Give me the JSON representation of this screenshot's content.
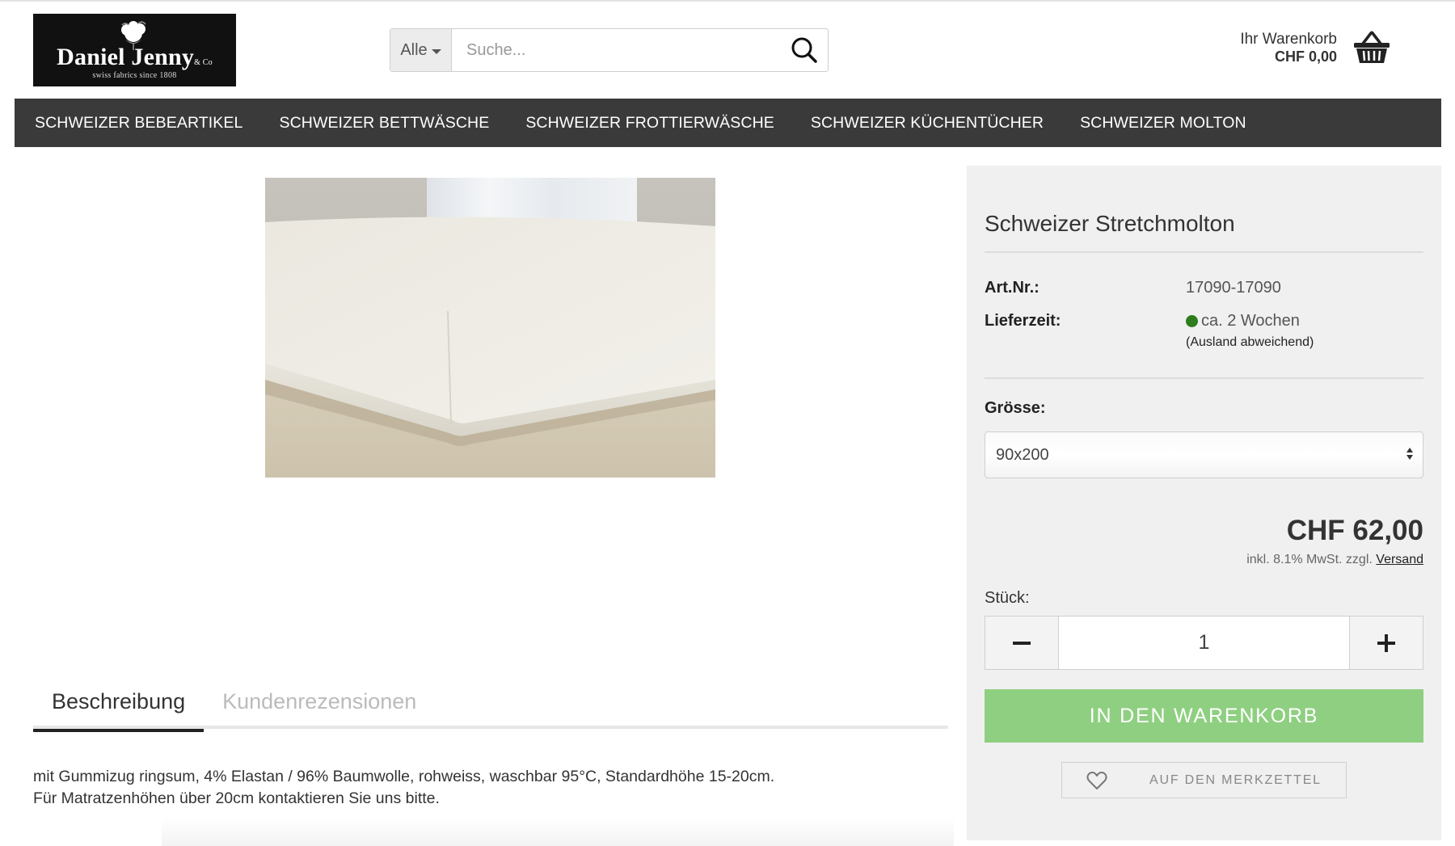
{
  "brand": {
    "name": "Daniel Jenny",
    "suffix": "& Co",
    "tagline": "swiss fabrics since 1808"
  },
  "search": {
    "category": "Alle",
    "placeholder": "Suche...",
    "icon": "search-icon"
  },
  "cart": {
    "label": "Ihr Warenkorb",
    "total": "CHF 0,00",
    "icon": "basket-icon"
  },
  "nav": {
    "items": [
      "SCHWEIZER BEBEARTIKEL",
      "SCHWEIZER BETTWÄSCHE",
      "SCHWEIZER FROTTIERWÄSCHE",
      "SCHWEIZER KÜCHENTÜCHER",
      "SCHWEIZER MOLTON"
    ]
  },
  "tabs": [
    {
      "label": "Beschreibung",
      "active": true
    },
    {
      "label": "Kundenrezensionen",
      "active": false
    }
  ],
  "description": {
    "line1": "mit Gummizug ringsum, 4% Elastan / 96% Baumwolle, rohweiss, waschbar 95°C, Standardhöhe 15-20cm.",
    "line2": "Für Matratzenhöhen über 20cm kontaktieren Sie uns bitte."
  },
  "product": {
    "title": "Schweizer Stretchmolton",
    "article_label": "Art.Nr.:",
    "article_number": "17090-17090",
    "delivery_label": "Lieferzeit:",
    "delivery_value": "ca. 2 Wochen",
    "delivery_note": "(Ausland abweichend)",
    "delivery_status_color": "#2e7d1d",
    "size_label": "Grösse:",
    "size_selected": "90x200",
    "price": "CHF 62,00",
    "price_note": "inkl. 8.1% MwSt. zzgl.",
    "shipping_link": "Versand",
    "quantity_label": "Stück:",
    "quantity": "1",
    "add_to_cart": "IN DEN WARENKORB",
    "add_to_cart_color": "#8fcf81",
    "wishlist": "AUF DEN MERKZETTEL",
    "wishlist_icon": "heart-icon"
  }
}
